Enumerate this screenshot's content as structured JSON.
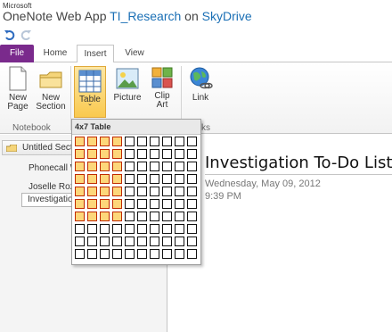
{
  "app": {
    "vendor": "Microsoft",
    "name": "OneNote Web App",
    "notebook": "TI_Research",
    "on_word": "on",
    "service": "SkyDrive"
  },
  "quick_access": {
    "undo_icon": "undo-icon",
    "redo_icon": "redo-icon"
  },
  "tabs": {
    "file": "File",
    "home": "Home",
    "insert": "Insert",
    "view": "View",
    "active": "Insert"
  },
  "ribbon": {
    "new_page": [
      "New",
      "Page"
    ],
    "new_section": [
      "New",
      "Section"
    ],
    "table": [
      "Table",
      "ˇ"
    ],
    "picture": "Picture",
    "clip_art": [
      "Clip",
      "Art"
    ],
    "link": "Link",
    "groups": {
      "notebook": "Notebook",
      "links": "ks"
    },
    "accent": "#f9c94e"
  },
  "table_picker": {
    "label": "4x7 Table",
    "cols_total": 10,
    "rows_total": 10,
    "selected_cols": 4,
    "selected_rows": 7,
    "selected_fill": "#fdd77a",
    "selected_border": "#c02a00"
  },
  "navigation": {
    "section": "Untitled Section",
    "pages": [
      "Phonecall W",
      "Joselle Roza",
      "Investigation"
    ]
  },
  "page": {
    "title": "Investigation To-Do List",
    "date": "Wednesday, May 09, 2012",
    "time": "9:39 PM"
  },
  "colors": {
    "file_tab": "#7a2a8c",
    "link_blue": "#1a6fb5"
  }
}
